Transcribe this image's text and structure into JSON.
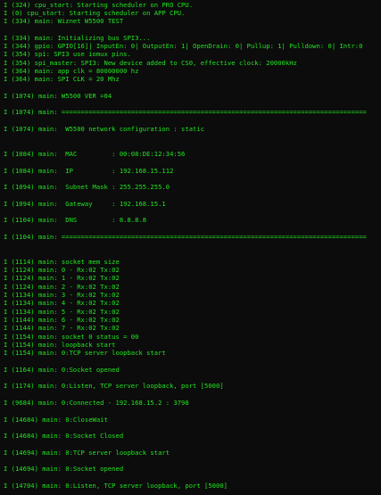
{
  "colors": {
    "background": "#0c0c0c",
    "log_text": "#22e322"
  },
  "log_lines": [
    "I (324) cpu_start: Starting scheduler on PRO CPU.",
    "I (0) cpu_start: Starting scheduler on APP CPU.",
    "I (334) main: Wiznet W5500 TEST",
    "",
    "I (334) main: Initializing bus SPI3...",
    "I (344) gpio: GPIO[16]| InputEn: 0| OutputEn: 1| OpenDrain: 0| Pullup: 1| Pulldown: 0| Intr:0",
    "I (354) spi: SPI3 use iomux pins.",
    "I (354) spi_master: SPI3: New device added to CS0, effective clock: 20000kHz",
    "I (364) main: app clk = 80000000 hz",
    "I (364) main: SPI CLK = 20 Mhz",
    "",
    "I (1074) main: W5500 VER =04",
    "",
    "I (1074) main: ===============================================================================",
    "",
    "I (1074) main:  W5500 network configuration : static",
    "",
    "",
    "I (1084) main:  MAC         : 00:08:DE:12:34:56",
    "",
    "I (1084) main:  IP          : 192.168.15.112",
    "",
    "I (1094) main:  Subnet Mask : 255.255.255.0",
    "",
    "I (1094) main:  Gateway     : 192.168.15.1",
    "",
    "I (1104) main:  DNS         : 8.8.8.8",
    "",
    "I (1104) main: ===============================================================================",
    "",
    "",
    "I (1114) main: socket mem size",
    "I (1124) main: 0 - Rx:02 Tx:02",
    "I (1124) main: 1 - Rx:02 Tx:02",
    "I (1124) main: 2 - Rx:02 Tx:02",
    "I (1134) main: 3 - Rx:02 Tx:02",
    "I (1134) main: 4 - Rx:02 Tx:02",
    "I (1134) main: 5 - Rx:02 Tx:02",
    "I (1144) main: 6 - Rx:02 Tx:02",
    "I (1144) main: 7 - Rx:02 Tx:02",
    "I (1154) main: socket 0 status = 00",
    "I (1154) main: loopback start",
    "I (1154) main: 0:TCP server loopback start",
    "",
    "I (1164) main: 0:Socket opened",
    "",
    "I (1174) main: 0:Listen, TCP server loopback, port [5000]",
    "",
    "I (9684) main: 0:Connected - 192.168.15.2 : 3798",
    "",
    "I (14684) main: 0:CloseWait",
    "",
    "I (14684) main: 0:Socket Closed",
    "",
    "I (14694) main: 0:TCP server loopback start",
    "",
    "I (14694) main: 0:Socket opened",
    "",
    "I (14704) main: 0:Listen, TCP server loopback, port [5000]"
  ]
}
